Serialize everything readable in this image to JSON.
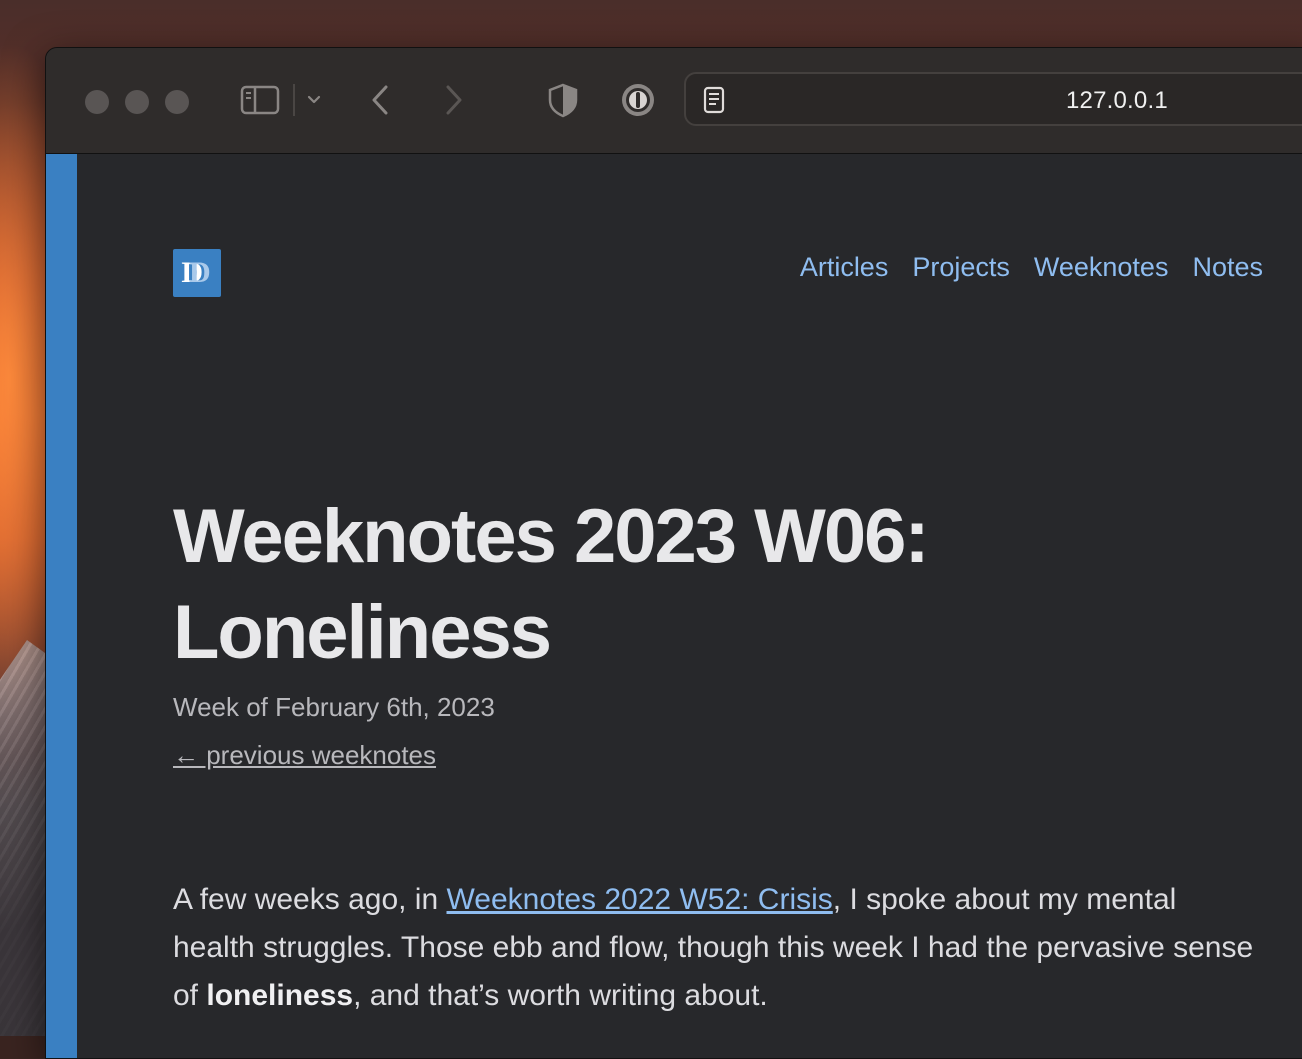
{
  "browser": {
    "url": "127.0.0.1"
  },
  "site": {
    "logo_text": "DD",
    "nav": [
      {
        "label": "Articles"
      },
      {
        "label": "Projects"
      },
      {
        "label": "Weeknotes"
      },
      {
        "label": "Notes"
      }
    ]
  },
  "post": {
    "title_line1": "Weeknotes 2023 W06:",
    "title_line2": "Loneliness",
    "subtitle": "Week of February 6th, 2023",
    "prev_link": "← previous weeknotes",
    "paragraph": {
      "part1": "A few weeks ago, in ",
      "link": "Weeknotes 2022 W52: Crisis",
      "part2": ", I spoke about my mental health struggles. Those ebb and flow, though this week I had the pervasive sense of ",
      "bold": "loneliness",
      "part3": ", and that’s worth writing about."
    }
  },
  "colors": {
    "accent": "#3a80c2",
    "link": "#8fbdf0",
    "page_bg": "#27282b"
  }
}
